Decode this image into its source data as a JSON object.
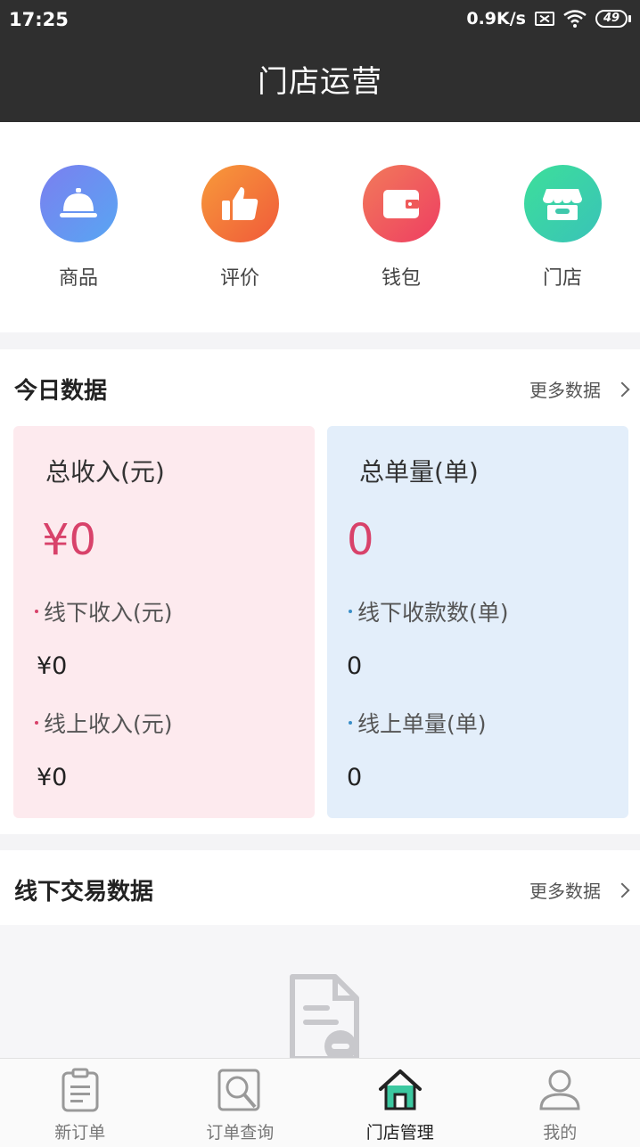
{
  "status": {
    "time": "17:25",
    "network_speed": "0.9K/s",
    "battery": "49"
  },
  "header": {
    "title": "门店运营"
  },
  "quick_actions": [
    {
      "label": "商品",
      "icon": "food-cover-icon",
      "color": "#6a8cf0"
    },
    {
      "label": "评价",
      "icon": "thumbs-up-icon",
      "color": "#f07a3a"
    },
    {
      "label": "钱包",
      "icon": "wallet-icon",
      "color": "#f0544f"
    },
    {
      "label": "门店",
      "icon": "store-icon",
      "color": "#3fd0a0"
    }
  ],
  "today": {
    "title": "今日数据",
    "more": "更多数据",
    "income_card": {
      "title": "总收入(元)",
      "total": "¥0",
      "offline_label": "线下收入(元)",
      "offline_value": "¥0",
      "online_label": "线上收入(元)",
      "online_value": "¥0"
    },
    "orders_card": {
      "title": "总单量(单)",
      "total": "0",
      "offline_label": "线下收款数(单)",
      "offline_value": "0",
      "online_label": "线上单量(单)",
      "online_value": "0"
    }
  },
  "offline_trade": {
    "title": "线下交易数据",
    "more": "更多数据"
  },
  "tabbar": [
    {
      "label": "新订单",
      "icon": "clipboard-icon"
    },
    {
      "label": "订单查询",
      "icon": "search-doc-icon"
    },
    {
      "label": "门店管理",
      "icon": "home-icon",
      "active": true
    },
    {
      "label": "我的",
      "icon": "user-icon"
    }
  ],
  "colors": {
    "accent_green": "#3cc8a0",
    "income_card_bg": "#fdeaee",
    "orders_card_bg": "#e3eefa",
    "big_number": "#d8426a"
  }
}
